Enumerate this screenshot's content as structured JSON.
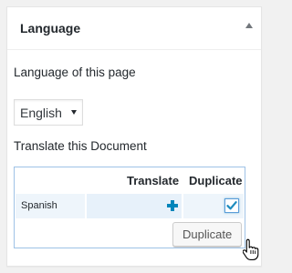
{
  "panel": {
    "title": "Language",
    "toggle_icon": "triangle-up-icon"
  },
  "language_of_page": {
    "label": "Language of this page",
    "selected": "English",
    "dropdown_icon": "caret-down-icon"
  },
  "translate": {
    "label": "Translate this Document",
    "columns": [
      "Translate",
      "Duplicate"
    ],
    "rows": [
      {
        "language": "Spanish",
        "translate_icon": "plus-icon",
        "duplicate_checked": true
      }
    ],
    "duplicate_button": "Duplicate"
  },
  "colors": {
    "accent": "#0085ba",
    "box_border": "#9ec2e6",
    "row_bg": "#eef5fb"
  }
}
